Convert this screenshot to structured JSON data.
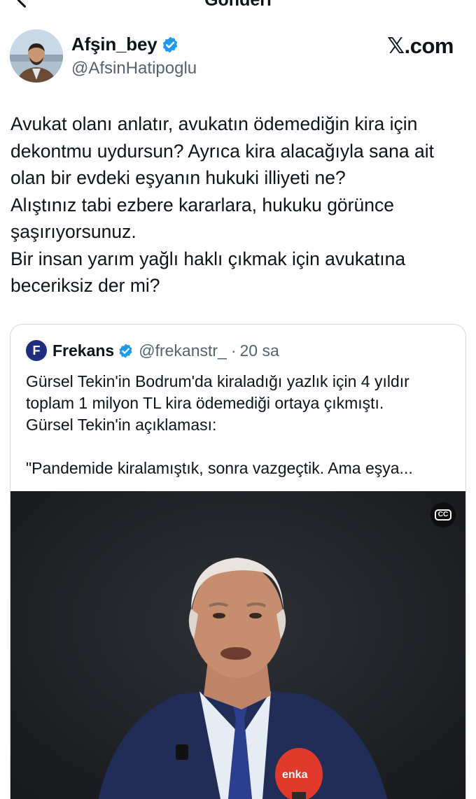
{
  "header": {
    "title": "Gönderi"
  },
  "author": {
    "display_name": "Afşin_bey",
    "handle": "@AfsinHatipoglu",
    "source_label": "𝕏.com"
  },
  "tweet": {
    "text": "Avukat olanı anlatır, avukatın ödemediğin kira için\ndekontmu uydursun? Ayrıca kira alacağıyla sana ait\nolan bir evdeki eşyanın hukuki illiyeti ne?\nAlıştınız tabi ezbere kararlara, hukuku görünce\nşaşırıyorsunuz.\nBir insan yarım yağlı haklı çıkmak için avukatına\nbeceriksiz der mi?"
  },
  "quote": {
    "logo_letter": "F",
    "name": "Frekans",
    "handle": "@frekanstr_",
    "separator": "·",
    "time": "20 sa",
    "text": "Gürsel Tekin'in Bodrum'da kiraladığı yazlık için 4 yıldır\ntoplam 1 milyon TL kira ödemediği ortaya çıkmıştı.\nGürsel Tekin'in açıklaması:\n\n\"Pandemide kiralamıştık, sonra vazgeçtik. Ama eşya...",
    "video": {
      "cc_label": "CC",
      "mic_label": "enka"
    }
  },
  "colors": {
    "text_primary": "#0f1419",
    "text_secondary": "#536471",
    "verified_blue": "#1d9bf0",
    "card_border": "#cfd9de",
    "logo_navy": "#1e2d7d"
  },
  "icons": {
    "back": "back-arrow-icon",
    "verified": "verified-badge-icon",
    "cc": "closed-captions-icon"
  }
}
